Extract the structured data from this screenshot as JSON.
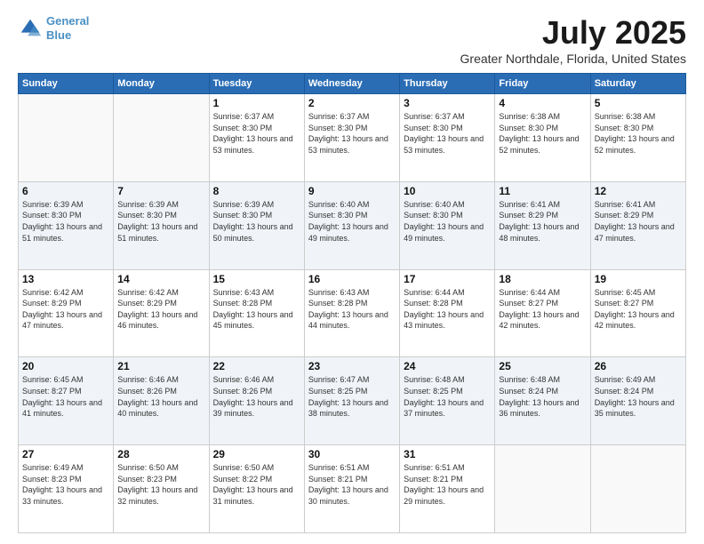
{
  "logo": {
    "line1": "General",
    "line2": "Blue"
  },
  "title": "July 2025",
  "subtitle": "Greater Northdale, Florida, United States",
  "weekdays": [
    "Sunday",
    "Monday",
    "Tuesday",
    "Wednesday",
    "Thursday",
    "Friday",
    "Saturday"
  ],
  "weeks": [
    [
      {
        "day": "",
        "info": ""
      },
      {
        "day": "",
        "info": ""
      },
      {
        "day": "1",
        "sunrise": "6:37 AM",
        "sunset": "8:30 PM",
        "daylight": "13 hours and 53 minutes."
      },
      {
        "day": "2",
        "sunrise": "6:37 AM",
        "sunset": "8:30 PM",
        "daylight": "13 hours and 53 minutes."
      },
      {
        "day": "3",
        "sunrise": "6:37 AM",
        "sunset": "8:30 PM",
        "daylight": "13 hours and 53 minutes."
      },
      {
        "day": "4",
        "sunrise": "6:38 AM",
        "sunset": "8:30 PM",
        "daylight": "13 hours and 52 minutes."
      },
      {
        "day": "5",
        "sunrise": "6:38 AM",
        "sunset": "8:30 PM",
        "daylight": "13 hours and 52 minutes."
      }
    ],
    [
      {
        "day": "6",
        "sunrise": "6:39 AM",
        "sunset": "8:30 PM",
        "daylight": "13 hours and 51 minutes."
      },
      {
        "day": "7",
        "sunrise": "6:39 AM",
        "sunset": "8:30 PM",
        "daylight": "13 hours and 51 minutes."
      },
      {
        "day": "8",
        "sunrise": "6:39 AM",
        "sunset": "8:30 PM",
        "daylight": "13 hours and 50 minutes."
      },
      {
        "day": "9",
        "sunrise": "6:40 AM",
        "sunset": "8:30 PM",
        "daylight": "13 hours and 49 minutes."
      },
      {
        "day": "10",
        "sunrise": "6:40 AM",
        "sunset": "8:30 PM",
        "daylight": "13 hours and 49 minutes."
      },
      {
        "day": "11",
        "sunrise": "6:41 AM",
        "sunset": "8:29 PM",
        "daylight": "13 hours and 48 minutes."
      },
      {
        "day": "12",
        "sunrise": "6:41 AM",
        "sunset": "8:29 PM",
        "daylight": "13 hours and 47 minutes."
      }
    ],
    [
      {
        "day": "13",
        "sunrise": "6:42 AM",
        "sunset": "8:29 PM",
        "daylight": "13 hours and 47 minutes."
      },
      {
        "day": "14",
        "sunrise": "6:42 AM",
        "sunset": "8:29 PM",
        "daylight": "13 hours and 46 minutes."
      },
      {
        "day": "15",
        "sunrise": "6:43 AM",
        "sunset": "8:28 PM",
        "daylight": "13 hours and 45 minutes."
      },
      {
        "day": "16",
        "sunrise": "6:43 AM",
        "sunset": "8:28 PM",
        "daylight": "13 hours and 44 minutes."
      },
      {
        "day": "17",
        "sunrise": "6:44 AM",
        "sunset": "8:28 PM",
        "daylight": "13 hours and 43 minutes."
      },
      {
        "day": "18",
        "sunrise": "6:44 AM",
        "sunset": "8:27 PM",
        "daylight": "13 hours and 42 minutes."
      },
      {
        "day": "19",
        "sunrise": "6:45 AM",
        "sunset": "8:27 PM",
        "daylight": "13 hours and 42 minutes."
      }
    ],
    [
      {
        "day": "20",
        "sunrise": "6:45 AM",
        "sunset": "8:27 PM",
        "daylight": "13 hours and 41 minutes."
      },
      {
        "day": "21",
        "sunrise": "6:46 AM",
        "sunset": "8:26 PM",
        "daylight": "13 hours and 40 minutes."
      },
      {
        "day": "22",
        "sunrise": "6:46 AM",
        "sunset": "8:26 PM",
        "daylight": "13 hours and 39 minutes."
      },
      {
        "day": "23",
        "sunrise": "6:47 AM",
        "sunset": "8:25 PM",
        "daylight": "13 hours and 38 minutes."
      },
      {
        "day": "24",
        "sunrise": "6:48 AM",
        "sunset": "8:25 PM",
        "daylight": "13 hours and 37 minutes."
      },
      {
        "day": "25",
        "sunrise": "6:48 AM",
        "sunset": "8:24 PM",
        "daylight": "13 hours and 36 minutes."
      },
      {
        "day": "26",
        "sunrise": "6:49 AM",
        "sunset": "8:24 PM",
        "daylight": "13 hours and 35 minutes."
      }
    ],
    [
      {
        "day": "27",
        "sunrise": "6:49 AM",
        "sunset": "8:23 PM",
        "daylight": "13 hours and 33 minutes."
      },
      {
        "day": "28",
        "sunrise": "6:50 AM",
        "sunset": "8:23 PM",
        "daylight": "13 hours and 32 minutes."
      },
      {
        "day": "29",
        "sunrise": "6:50 AM",
        "sunset": "8:22 PM",
        "daylight": "13 hours and 31 minutes."
      },
      {
        "day": "30",
        "sunrise": "6:51 AM",
        "sunset": "8:21 PM",
        "daylight": "13 hours and 30 minutes."
      },
      {
        "day": "31",
        "sunrise": "6:51 AM",
        "sunset": "8:21 PM",
        "daylight": "13 hours and 29 minutes."
      },
      {
        "day": "",
        "info": ""
      },
      {
        "day": "",
        "info": ""
      }
    ]
  ],
  "labels": {
    "sunrise_prefix": "Sunrise: ",
    "sunset_prefix": "Sunset: ",
    "daylight_prefix": "Daylight: "
  }
}
